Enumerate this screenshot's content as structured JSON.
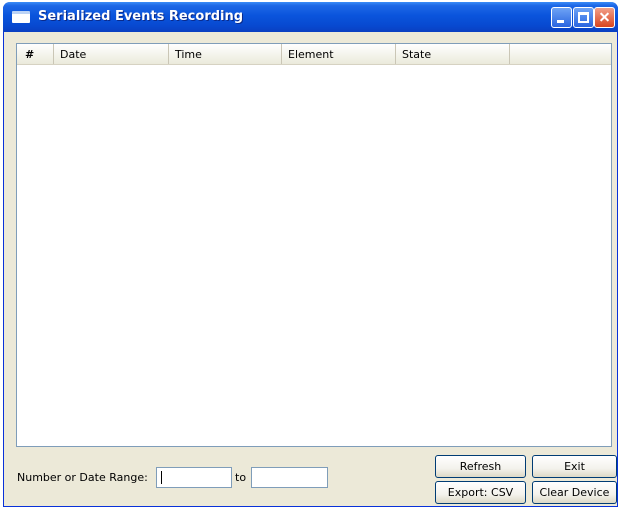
{
  "window": {
    "title": "Serialized Events Recording",
    "accent_color": "#0a54dc",
    "close_color": "#d9451f",
    "icons": {
      "app": "window-icon",
      "minimize": "minimize-icon",
      "maximize": "maximize-icon",
      "close": "close-icon"
    }
  },
  "table": {
    "columns": [
      "#",
      "Date",
      "Time",
      "Element",
      "State",
      ""
    ],
    "rows": []
  },
  "range": {
    "label": "Number or Date Range:",
    "from_value": "",
    "to_label": "to",
    "to_value": ""
  },
  "buttons": {
    "refresh": "Refresh",
    "exit": "Exit",
    "export": "Export: CSV",
    "clear": "Clear Device"
  }
}
